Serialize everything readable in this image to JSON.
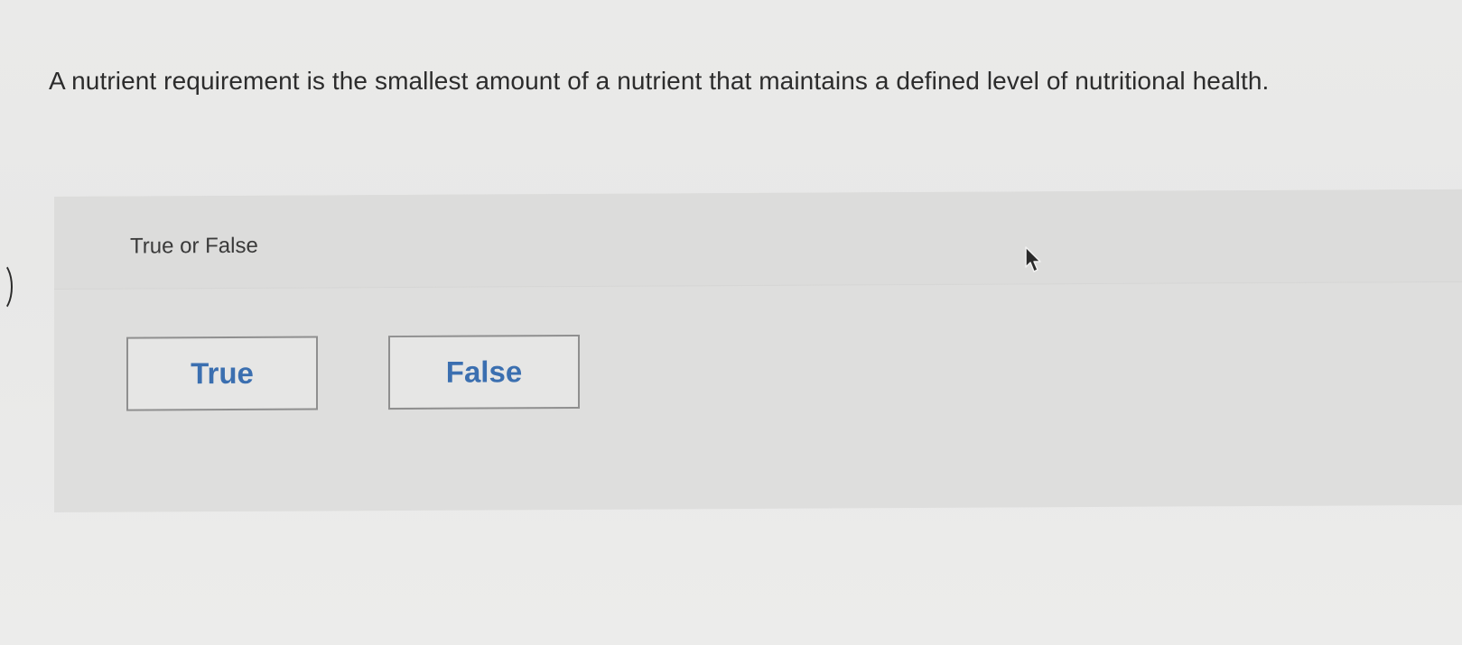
{
  "question": {
    "text": "A nutrient requirement is the smallest amount of a nutrient that maintains a defined level of nutritional health."
  },
  "answer_panel": {
    "prompt": "True or False",
    "choices": [
      {
        "label": "True"
      },
      {
        "label": "False"
      }
    ]
  },
  "colors": {
    "choice_text": "#3b6fb0",
    "background": "#e9e9e8",
    "panel": "#dededd"
  },
  "icons": {
    "cursor": "mouse-pointer-icon"
  }
}
